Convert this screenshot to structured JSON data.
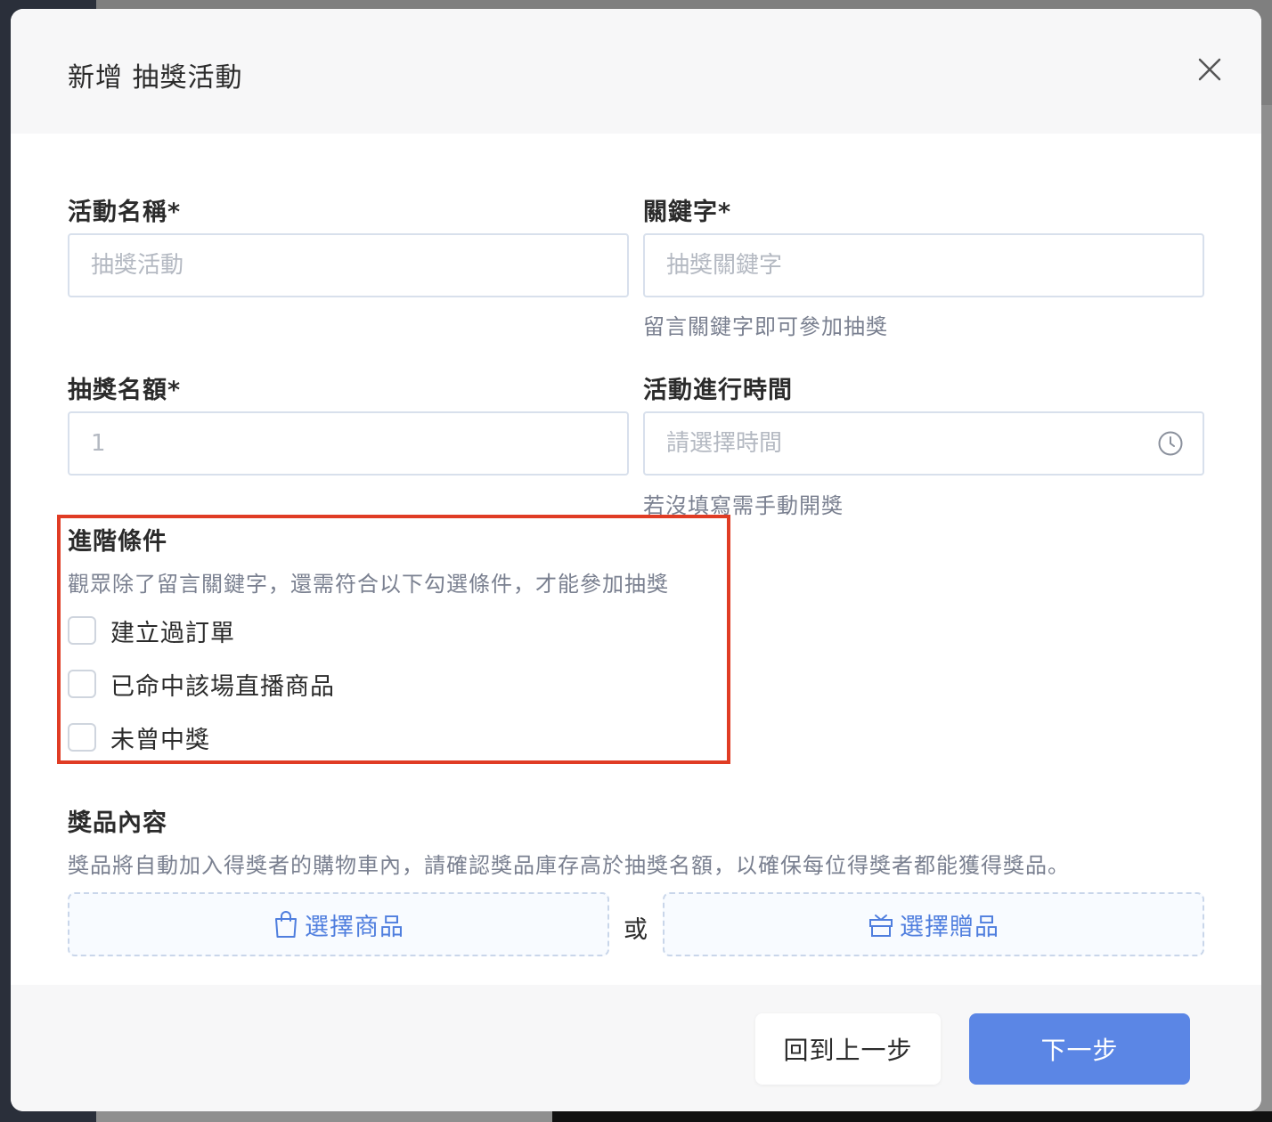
{
  "modal": {
    "title": "新增 抽獎活動"
  },
  "form": {
    "activity_name": {
      "label": "活動名稱*",
      "placeholder": "抽獎活動",
      "value": ""
    },
    "keyword": {
      "label": "關鍵字*",
      "placeholder": "抽獎關鍵字",
      "helper": "留言關鍵字即可參加抽獎",
      "value": ""
    },
    "winner_count": {
      "label": "抽獎名額*",
      "placeholder": "1",
      "value": ""
    },
    "time": {
      "label": "活動進行時間",
      "placeholder": "請選擇時間",
      "helper": "若沒填寫需手動開獎",
      "icon": "clock-icon"
    }
  },
  "advanced": {
    "title": "進階條件",
    "description": "觀眾除了留言關鍵字，還需符合以下勾選條件，才能參加抽獎",
    "options": [
      {
        "label": "建立過訂單",
        "checked": false
      },
      {
        "label": "已命中該場直播商品",
        "checked": false
      },
      {
        "label": "未曾中獎",
        "checked": false
      }
    ]
  },
  "prize": {
    "title": "獎品內容",
    "description": "獎品將自動加入得獎者的購物車內，請確認獎品庫存高於抽獎名額，以確保每位得獎者都能獲得獎品。",
    "select_product": "選擇商品",
    "or": "或",
    "select_gift": "選擇贈品"
  },
  "footer": {
    "back": "回到上一步",
    "next": "下一步"
  },
  "colors": {
    "primary": "#5b86e5",
    "highlight": "#e03c24",
    "link": "#4f7ede"
  }
}
